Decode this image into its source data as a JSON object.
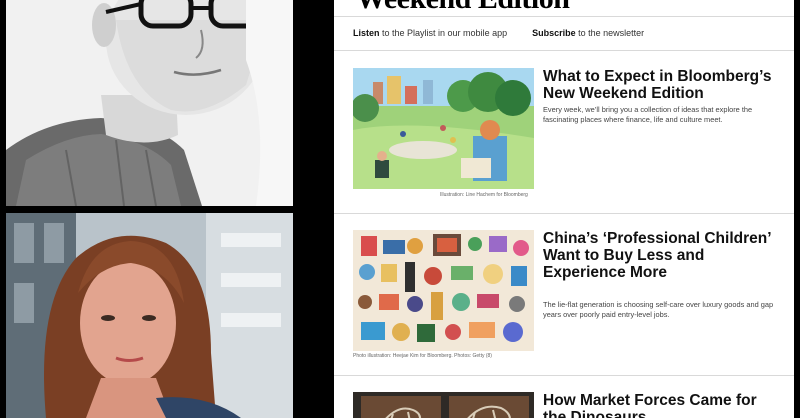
{
  "newsletter": {
    "masthead": "Weekend Edition",
    "listen_bold": "Listen",
    "listen_rest": " to the Playlist in our mobile app",
    "subscribe_bold": "Subscribe",
    "subscribe_rest": " to the newsletter"
  },
  "articles": [
    {
      "headline": "What to Expect in Bloomberg’s New Weekend Edition",
      "dek": "Every week, we’ll bring you a collection of ideas that explore the fascinating places where finance, life and culture meet.",
      "caption": "Illustration: Line Hachem for Bloomberg"
    },
    {
      "headline": "China’s ‘Professional Children’ Want to Buy Less and Experience More",
      "dek": "The lie-flat generation is choosing self-care over luxury goods and gap years over poorly paid entry-level jobs.",
      "caption": "Photo illustration: Heejae Kim for Bloomberg. Photos: Getty (8)"
    },
    {
      "headline": "How Market Forces Came for the Dinosaurs"
    }
  ]
}
